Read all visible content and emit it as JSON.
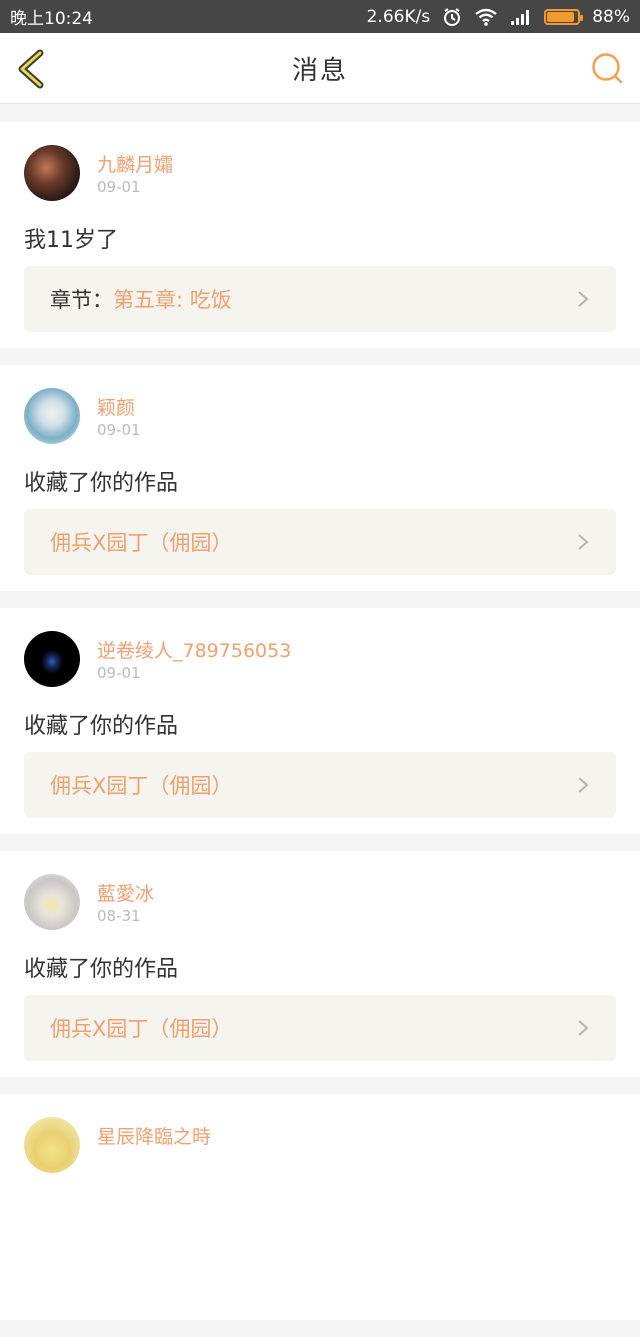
{
  "status_bar": {
    "time": "晚上10:24",
    "net_speed": "2.66K/s",
    "battery": "88%",
    "battery_level": 0.88
  },
  "header": {
    "title": "消息",
    "back_icon": "chevron-left-icon",
    "search_icon": "search-icon"
  },
  "colors": {
    "accent": "#f39b2a",
    "name": "#f0a070",
    "link_bg": "#f5f4ee"
  },
  "messages": [
    {
      "user": "九麟月孀",
      "date": "09-01",
      "text": "我11岁了",
      "link_prefix": "章节：",
      "link_target": "第五章: 吃饭"
    },
    {
      "user": "颖颜",
      "date": "09-01",
      "text": "收藏了你的作品",
      "link_prefix": "",
      "link_target": "佣兵X园丁（佣园）"
    },
    {
      "user": "逆卷绫人_789756053",
      "date": "09-01",
      "text": "收藏了你的作品",
      "link_prefix": "",
      "link_target": "佣兵X园丁（佣园）"
    },
    {
      "user": "藍愛冰",
      "date": "08-31",
      "text": "收藏了你的作品",
      "link_prefix": "",
      "link_target": "佣兵X园丁（佣园）"
    },
    {
      "user": "星辰降臨之時",
      "date": "",
      "text": "",
      "link_prefix": "",
      "link_target": ""
    }
  ]
}
